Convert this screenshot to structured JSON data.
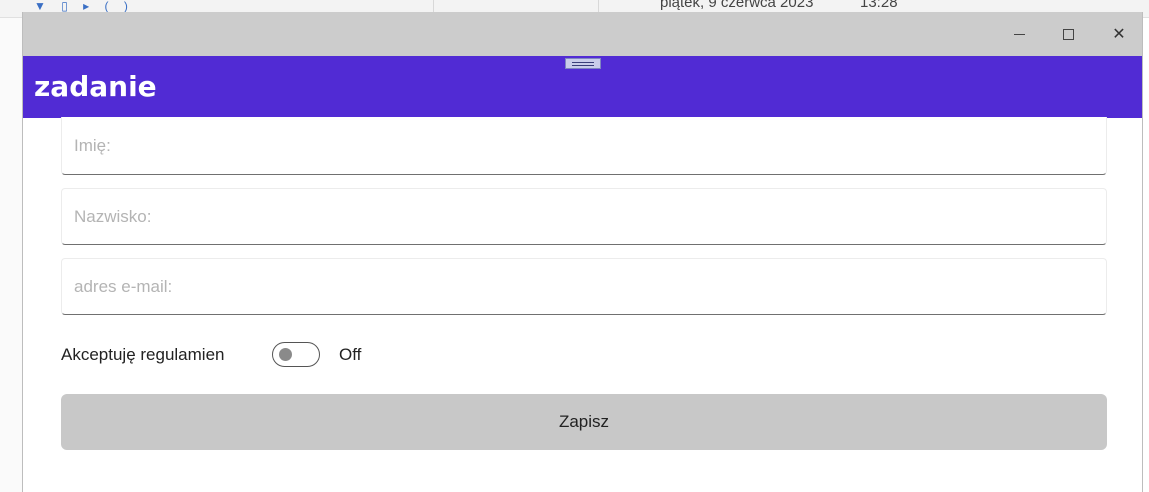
{
  "background": {
    "taskbar_date": "piątek, 9 czerwca 2023",
    "taskbar_time": "13:28"
  },
  "window": {
    "controls": {
      "minimize_icon": "minimize-icon",
      "maximize_icon": "maximize-icon",
      "close_icon": "close-icon",
      "close_glyph": "✕"
    }
  },
  "appbar": {
    "title": "zadanie",
    "color": "#512bd4"
  },
  "form": {
    "first_name": {
      "value": "",
      "placeholder": "Imię:"
    },
    "last_name": {
      "value": "",
      "placeholder": "Nazwisko:"
    },
    "email": {
      "value": "",
      "placeholder": "adres e-mail:"
    },
    "consent": {
      "label": "Akceptuję regulamien",
      "toggle_state": "Off",
      "checked": false
    },
    "save_label": "Zapisz",
    "save_color": "#c8c8c8"
  }
}
